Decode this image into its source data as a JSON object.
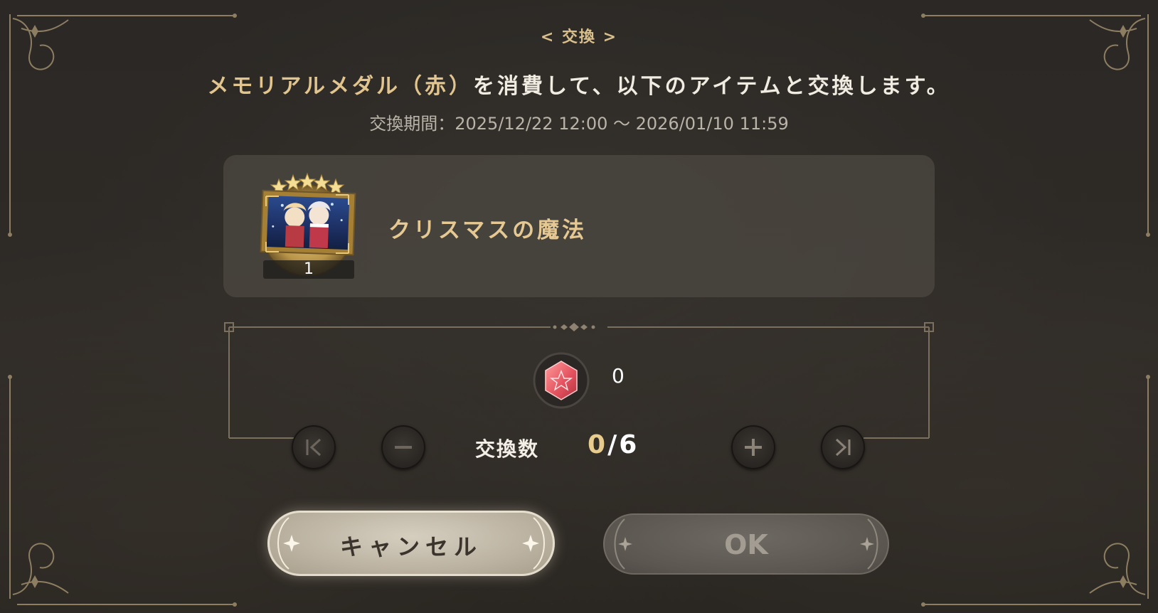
{
  "dialog": {
    "heading": "< 交換 >",
    "message_medal": "メモリアルメダル（赤）",
    "message_rest": "を消費して、以下のアイテムと交換します。",
    "period": "交換期間：2025/12/22 12:00 ～ 2026/01/10 11:59"
  },
  "item": {
    "name": "クリスマスの魔法",
    "count": "1",
    "rarity_stars": 5,
    "thumbnail_icon": "memory-card-icon"
  },
  "medal": {
    "icon": "red-memorial-medal-icon",
    "owned": "0"
  },
  "quantity": {
    "label": "交換数",
    "current": "0",
    "separator": "/",
    "max": "6"
  },
  "buttons": {
    "cancel": "キャンセル",
    "ok": "OK"
  },
  "colors": {
    "accent_gold": "#e2c48e",
    "medal_red": "#e85a5a",
    "background": "#2a2723"
  }
}
